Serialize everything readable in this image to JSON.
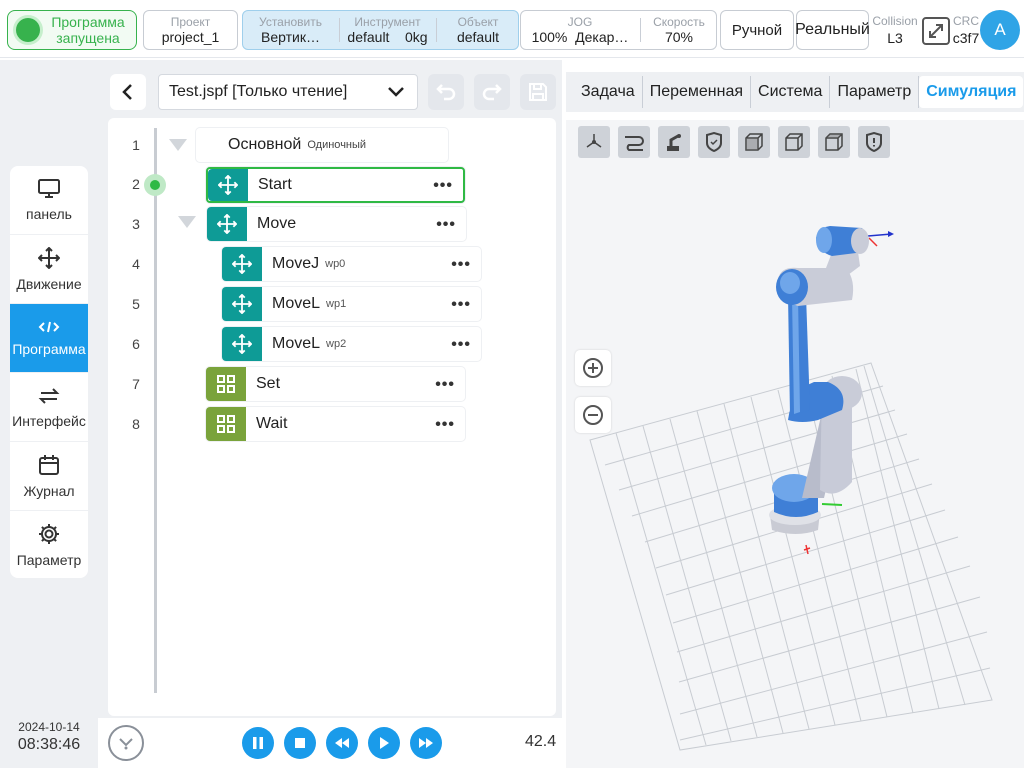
{
  "topbar": {
    "status": "Программа запущена",
    "project": {
      "label": "Проект",
      "value": "project_1"
    },
    "install": {
      "label": "Установить",
      "value": "Вертик…"
    },
    "tool": {
      "label": "Инструмент",
      "value": "default",
      "extra": "0kg"
    },
    "object": {
      "label": "Объект",
      "value": "default"
    },
    "jog": {
      "label": "JOG",
      "value": "100%",
      "extra": "Декар…"
    },
    "speed": {
      "label": "Скорость",
      "value": "70%"
    },
    "mode": "Ручной",
    "realmode": "Реальный",
    "collision": {
      "label": "Collision",
      "value": "L3"
    },
    "crc": {
      "label": "CRC",
      "value": "c3f7"
    },
    "avatar": "A"
  },
  "nav": {
    "items": [
      {
        "label": "панель",
        "icon": "monitor-icon"
      },
      {
        "label": "Движение",
        "icon": "move-icon"
      },
      {
        "label": "Программа",
        "icon": "code-icon"
      },
      {
        "label": "Интерфейс",
        "icon": "swap-icon"
      },
      {
        "label": "Журнал",
        "icon": "calendar-icon"
      },
      {
        "label": "Параметр",
        "icon": "gear-icon"
      }
    ],
    "active": "Программа"
  },
  "datetime": {
    "date": "2024-10-14",
    "time": "08:38:46"
  },
  "file": {
    "name": "Test.jspf [Только чтение]"
  },
  "tree": {
    "line_numbers": [
      "1",
      "2",
      "3",
      "4",
      "5",
      "6",
      "7",
      "8"
    ],
    "root": {
      "name": "Основной",
      "sub": "Одиночный"
    },
    "nodes": [
      {
        "name": "Start",
        "sub": "",
        "type": "move"
      },
      {
        "name": "Move",
        "sub": "",
        "type": "move"
      },
      {
        "name": "MoveJ",
        "sub": "wp0",
        "type": "move"
      },
      {
        "name": "MoveL",
        "sub": "wp1",
        "type": "move"
      },
      {
        "name": "MoveL",
        "sub": "wp2",
        "type": "move"
      },
      {
        "name": "Set",
        "sub": "",
        "type": "io"
      },
      {
        "name": "Wait",
        "sub": "",
        "type": "io"
      }
    ],
    "active_line": 2
  },
  "playback": {
    "speed": "42.4"
  },
  "tabs": [
    "Задача",
    "Переменная",
    "Система",
    "Параметр",
    "Симуляция"
  ],
  "active_tab": "Симуляция",
  "colors": {
    "accent": "#1a9bea",
    "running": "#37b24d",
    "teal": "#0e9b96",
    "olive": "#7aa33b",
    "robot": "#3f7fd6"
  }
}
